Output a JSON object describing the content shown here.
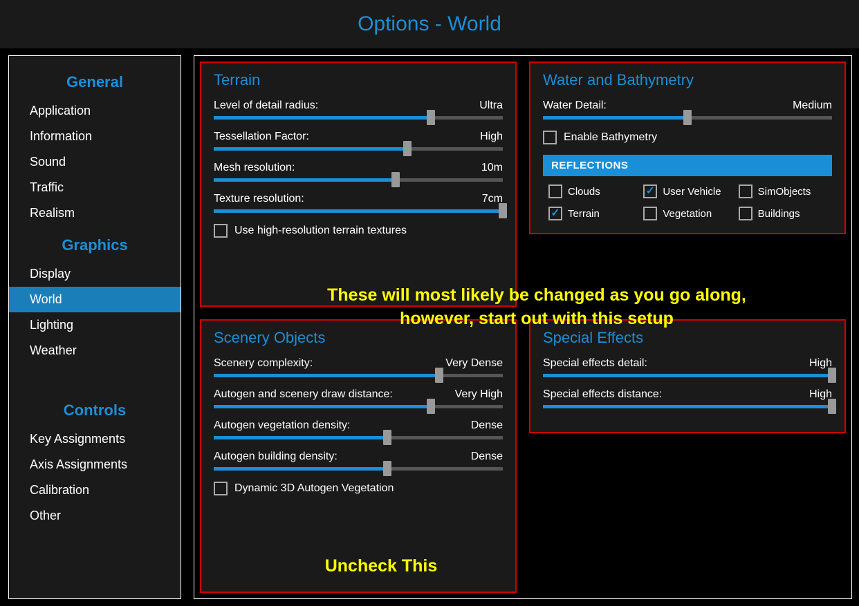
{
  "title": "Options - World",
  "sidebar": {
    "sections": [
      {
        "header": "General",
        "items": [
          {
            "label": "Application",
            "active": false
          },
          {
            "label": "Information",
            "active": false
          },
          {
            "label": "Sound",
            "active": false
          },
          {
            "label": "Traffic",
            "active": false
          },
          {
            "label": "Realism",
            "active": false
          }
        ]
      },
      {
        "header": "Graphics",
        "items": [
          {
            "label": "Display",
            "active": false
          },
          {
            "label": "World",
            "active": true
          },
          {
            "label": "Lighting",
            "active": false
          },
          {
            "label": "Weather",
            "active": false
          }
        ]
      },
      {
        "header": "Controls",
        "items": [
          {
            "label": "Key Assignments",
            "active": false
          },
          {
            "label": "Axis Assignments",
            "active": false
          },
          {
            "label": "Calibration",
            "active": false
          },
          {
            "label": "Other",
            "active": false
          }
        ]
      }
    ]
  },
  "panels": {
    "terrain": {
      "title": "Terrain",
      "sliders": [
        {
          "label": "Level of detail radius:",
          "value": "Ultra",
          "pos": 75
        },
        {
          "label": "Tessellation Factor:",
          "value": "High",
          "pos": 67
        },
        {
          "label": "Mesh resolution:",
          "value": "10m",
          "pos": 63
        },
        {
          "label": "Texture resolution:",
          "value": "7cm",
          "pos": 100
        }
      ],
      "checkbox": {
        "label": "Use high-resolution terrain textures",
        "checked": false
      }
    },
    "water": {
      "title": "Water and Bathymetry",
      "sliders": [
        {
          "label": "Water Detail:",
          "value": "Medium",
          "pos": 50
        }
      ],
      "checkbox": {
        "label": "Enable Bathymetry",
        "checked": false
      },
      "reflections_header": "REFLECTIONS",
      "reflections": [
        {
          "label": "Clouds",
          "checked": false
        },
        {
          "label": "User Vehicle",
          "checked": true
        },
        {
          "label": "SimObjects",
          "checked": false
        },
        {
          "label": "Terrain",
          "checked": true
        },
        {
          "label": "Vegetation",
          "checked": false
        },
        {
          "label": "Buildings",
          "checked": false
        }
      ]
    },
    "scenery": {
      "title": "Scenery Objects",
      "sliders": [
        {
          "label": "Scenery complexity:",
          "value": "Very Dense",
          "pos": 78
        },
        {
          "label": "Autogen and scenery draw distance:",
          "value": "Very High",
          "pos": 75
        },
        {
          "label": "Autogen vegetation density:",
          "value": "Dense",
          "pos": 60
        },
        {
          "label": "Autogen building density:",
          "value": "Dense",
          "pos": 60
        }
      ],
      "checkbox": {
        "label": "Dynamic 3D Autogen Vegetation",
        "checked": false
      }
    },
    "effects": {
      "title": "Special Effects",
      "sliders": [
        {
          "label": "Special effects detail:",
          "value": "High",
          "pos": 100
        },
        {
          "label": "Special effects distance:",
          "value": "High",
          "pos": 100
        }
      ]
    }
  },
  "annotations": {
    "main": "These will most likely be changed as you go along,\nhowever, start out with this setup",
    "uncheck": "Uncheck This"
  }
}
